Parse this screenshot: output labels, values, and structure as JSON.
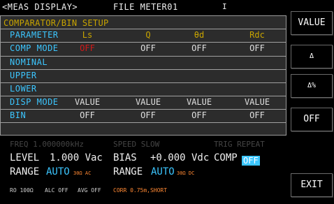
{
  "topbar": {
    "mode": "<MEAS DISPLAY>",
    "file": "FILE METER01",
    "cursor": "I"
  },
  "panel": {
    "title": "COMPARATOR/BIN SETUP",
    "header": {
      "label": "PARAMETER",
      "cols": [
        "Ls",
        "Q",
        "θd",
        "Rdc"
      ]
    },
    "rows": [
      {
        "label": "COMP MODE",
        "values": [
          "OFF",
          "OFF",
          "OFF",
          "OFF"
        ]
      },
      {
        "label": "NOMINAL",
        "values": []
      },
      {
        "label": "UPPER",
        "values": []
      },
      {
        "label": "LOWER",
        "values": []
      },
      {
        "label": "DISP MODE",
        "values": [
          "VALUE",
          "VALUE",
          "VALUE",
          "VALUE"
        ]
      },
      {
        "label": "BIN",
        "values": [
          "OFF",
          "OFF",
          "OFF",
          "OFF"
        ]
      }
    ]
  },
  "status": {
    "faded": {
      "freq": "FREQ  1.000000kHz",
      "speed": "SPEED SLOW",
      "trig": "TRIG REPEAT"
    },
    "level_label": "LEVEL",
    "level_value": "1.000 Vac",
    "bias_label": "BIAS",
    "bias_value": "+0.000 Vdc",
    "comp_label": "COMP",
    "comp_value": "OFF",
    "range_label": "RANGE",
    "range_ac_value": "AUTO",
    "range_ac_note": "30Ω  AC",
    "range_dc_value": "AUTO",
    "range_dc_note": "30Ω  DC",
    "ro": "RO 100Ω",
    "alc": "ALC OFF",
    "avg": "AVG OFF",
    "corr": "CORR 0.75m,SHORT"
  },
  "softkeys": [
    "VALUE",
    "Δ",
    "Δ%",
    "OFF",
    "EXIT"
  ]
}
